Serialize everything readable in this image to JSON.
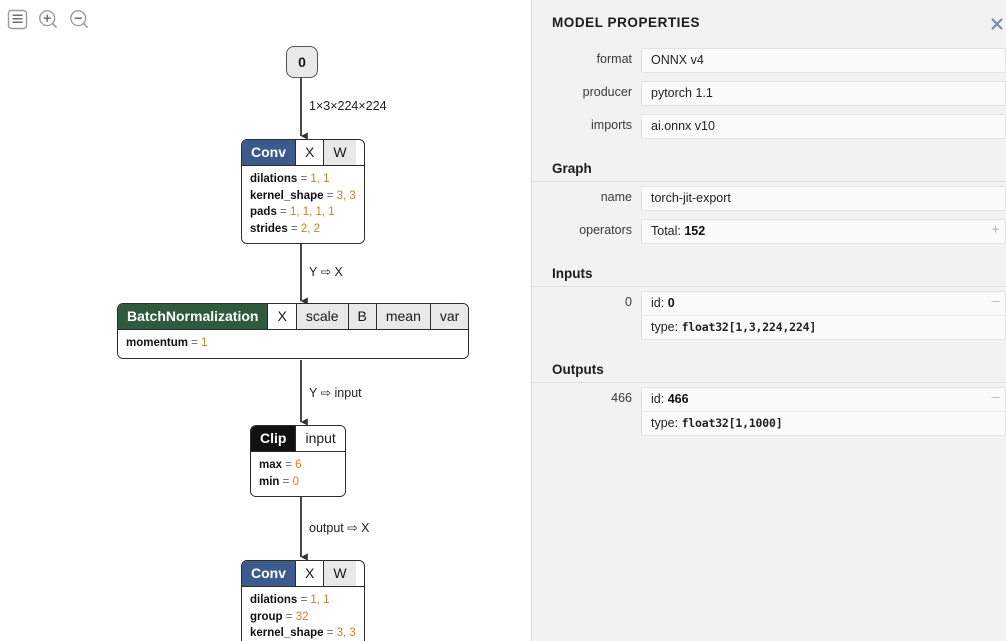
{
  "toolbar": {
    "buttons": [
      {
        "name": "menu-icon",
        "title": "Menu"
      },
      {
        "name": "zoom-in-icon",
        "title": "Zoom In"
      },
      {
        "name": "zoom-out-icon",
        "title": "Zoom Out"
      }
    ]
  },
  "graph": {
    "input_node": {
      "label": "0"
    },
    "edges": [
      {
        "label": "1×3×224×224"
      },
      {
        "label": "Y ⇨ X"
      },
      {
        "label": "Y ⇨ input"
      },
      {
        "label": "output ⇨ X"
      }
    ],
    "nodes": [
      {
        "type": "Conv",
        "header_color": "#3c5a8c",
        "inputs": [
          {
            "label": "X",
            "style": "white"
          },
          {
            "label": "W",
            "style": "gray"
          }
        ],
        "attributes": [
          {
            "name": "dilations",
            "value": "1, 1"
          },
          {
            "name": "kernel_shape",
            "value": "3, 3"
          },
          {
            "name": "pads",
            "value": "1, 1, 1, 1"
          },
          {
            "name": "strides",
            "value": "2, 2"
          }
        ]
      },
      {
        "type": "BatchNormalization",
        "header_color": "#2f5a3e",
        "inputs": [
          {
            "label": "X",
            "style": "white"
          },
          {
            "label": "scale",
            "style": "gray"
          },
          {
            "label": "B",
            "style": "gray"
          },
          {
            "label": "mean",
            "style": "gray"
          },
          {
            "label": "var",
            "style": "gray"
          }
        ],
        "attributes": [
          {
            "name": "momentum",
            "value": "1"
          }
        ]
      },
      {
        "type": "Clip",
        "header_color": "#111111",
        "inputs": [
          {
            "label": "input",
            "style": "white"
          }
        ],
        "attributes": [
          {
            "name": "max",
            "value": "6"
          },
          {
            "name": "min",
            "value": "0"
          }
        ]
      },
      {
        "type": "Conv",
        "header_color": "#3c5a8c",
        "inputs": [
          {
            "label": "X",
            "style": "white"
          },
          {
            "label": "W",
            "style": "gray"
          }
        ],
        "attributes": [
          {
            "name": "dilations",
            "value": "1, 1"
          },
          {
            "name": "group",
            "value": "32"
          },
          {
            "name": "kernel_shape",
            "value": "3, 3"
          }
        ]
      }
    ]
  },
  "sidebar": {
    "title": "MODEL PROPERTIES",
    "close_label": "✕",
    "model": {
      "rows": [
        {
          "label": "format",
          "value": "ONNX v4"
        },
        {
          "label": "producer",
          "value": "pytorch 1.1"
        },
        {
          "label": "imports",
          "value": "ai.onnx v10"
        }
      ]
    },
    "graph_section": {
      "title": "Graph",
      "rows": [
        {
          "label": "name",
          "value": "torch-jit-export",
          "expander": ""
        },
        {
          "label": "operators",
          "prefix": "Total: ",
          "value": "152",
          "expander": "+"
        }
      ]
    },
    "inputs_section": {
      "title": "Inputs",
      "items": [
        {
          "index": "0",
          "id_label": "id: ",
          "id_value": "0",
          "type_label": "type: ",
          "type_value": "float32[1,3,224,224]",
          "expander": "–"
        }
      ]
    },
    "outputs_section": {
      "title": "Outputs",
      "items": [
        {
          "index": "466",
          "id_label": "id: ",
          "id_value": "466",
          "type_label": "type: ",
          "type_value": "float32[1,1000]",
          "expander": "–"
        }
      ]
    }
  }
}
